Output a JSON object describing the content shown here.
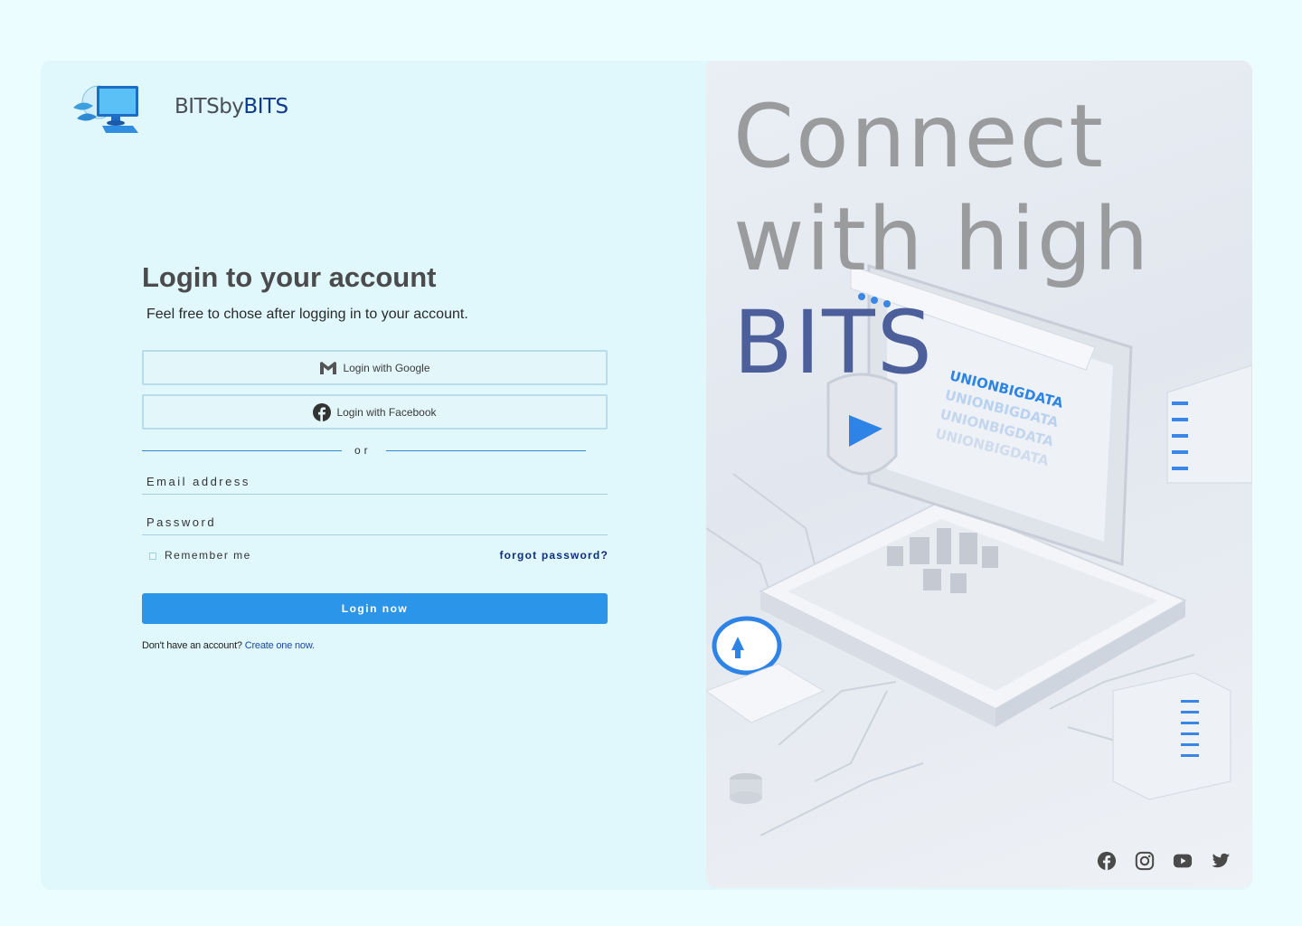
{
  "brand": {
    "name_part1": "BITSby",
    "name_part2": "BITS"
  },
  "login": {
    "title": "Login to your account",
    "subtitle": "Feel free to chose after logging  in to your account.",
    "google_label": "Login with Google",
    "facebook_label": "Login with Facebook",
    "divider_text": "or",
    "email_placeholder": "Email address",
    "password_placeholder": "Password",
    "remember_label": "Remember me",
    "forgot_label": "forgot password?",
    "submit_label": "Login now",
    "signup_prompt": "Don't have an account?",
    "signup_link": "Create one now."
  },
  "hero": {
    "line1": "Connect",
    "line2": "with high",
    "line3": "BITS",
    "screen_text": "UNIONBIGDATA"
  },
  "social_icons": [
    "facebook-icon",
    "instagram-icon",
    "youtube-icon",
    "twitter-icon"
  ],
  "colors": {
    "page_bg": "#ebfdfe",
    "card_bg": "#e0f7fb",
    "primary": "#2b95e9",
    "brand_dark": "#0d3a8c",
    "hero_accent": "#4c5f9a"
  }
}
